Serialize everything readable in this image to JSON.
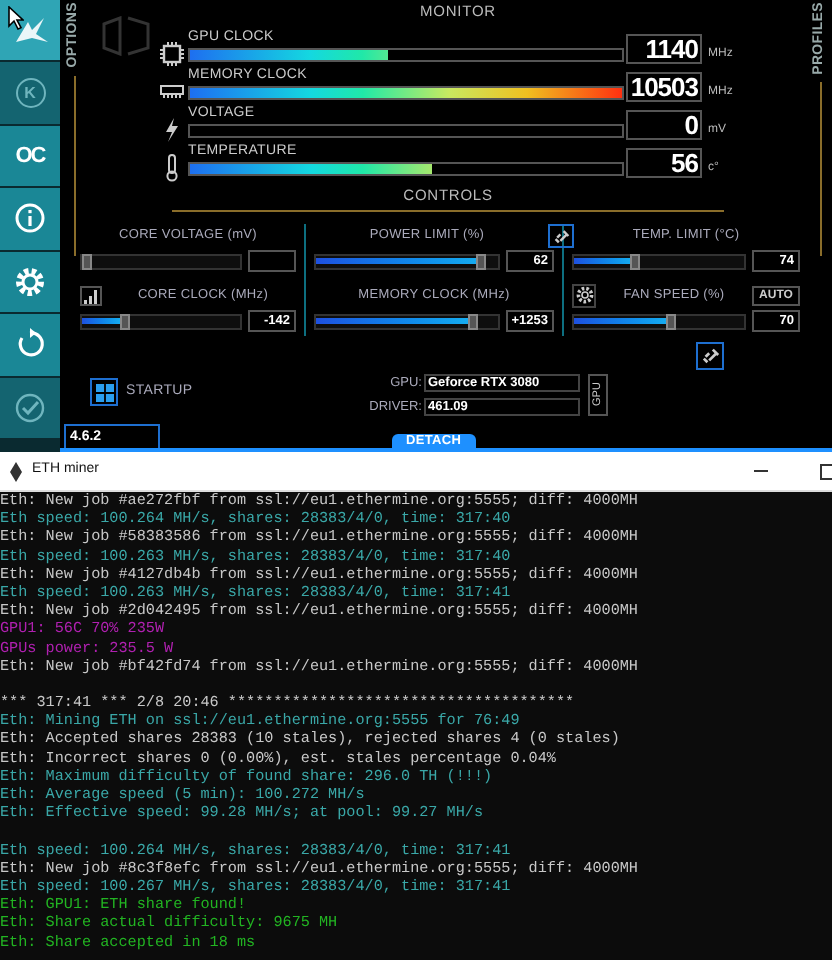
{
  "sidebar": {
    "items": [
      {
        "kind": "logo",
        "selected": true,
        "disabled": false
      },
      {
        "kind": "badge",
        "label": "K",
        "selected": false,
        "disabled": true
      },
      {
        "kind": "text",
        "label": "OC",
        "selected": false,
        "disabled": false
      },
      {
        "kind": "info",
        "selected": false,
        "disabled": false
      },
      {
        "kind": "settings",
        "selected": false,
        "disabled": false
      },
      {
        "kind": "reset",
        "selected": false,
        "disabled": false
      },
      {
        "kind": "apply",
        "selected": false,
        "disabled": true
      }
    ]
  },
  "options_label": "OPTIONS",
  "profiles_label": "PROFILES",
  "monitor": {
    "title": "MONITOR",
    "rows": [
      {
        "kind": "chip",
        "label": "GPU CLOCK",
        "level": 0.46,
        "value": "1140",
        "unit": "MHz"
      },
      {
        "kind": "memory",
        "label": "MEMORY CLOCK",
        "level": 1,
        "value": "10503",
        "unit": "MHz"
      },
      {
        "kind": "voltage",
        "label": "VOLTAGE",
        "level": 0,
        "value": "0",
        "unit": "mV"
      },
      {
        "kind": "temperature",
        "label": "TEMPERATURE",
        "level": 0.56,
        "value": "56",
        "unit": "c°"
      }
    ]
  },
  "controls": {
    "title": "CONTROLS",
    "sliders": [
      {
        "label": "CORE VOLTAGE (mV)",
        "level": 0
      },
      {
        "label": "POWER LIMIT (%)",
        "level": 0.93,
        "value": "62"
      },
      {
        "label": "TEMP. LIMIT (°C)",
        "level": 0.35,
        "value": "74"
      },
      {
        "label": "CORE CLOCK (MHz)",
        "level": 0.25,
        "value": "-142",
        "kind": "curve"
      },
      {
        "label": "MEMORY CLOCK (MHz)",
        "level": 0.88,
        "value": "+1253"
      },
      {
        "label": "FAN SPEED (%)",
        "level": 0.58,
        "value": "70",
        "kind": "fan",
        "button": "AUTO"
      }
    ]
  },
  "startup": "STARTUP",
  "gpu_info": {
    "gpu_label": "GPU:",
    "gpu": "Geforce RTX 3080",
    "driver_label": "DRIVER:",
    "driver": "461.09",
    "gpu_tab": "GPU"
  },
  "version": "4.6.2",
  "detach": "DETACH",
  "terminal": {
    "title": "ETH miner",
    "lines": [
      {
        "kind": "info",
        "text": "Eth: New job #ae272fbf from ssl://eu1.ethermine.org:5555; diff: 4000MH"
      },
      {
        "kind": "speed",
        "text": "Eth speed: 100.264 MH/s, shares: 28383/4/0, time: 317:40"
      },
      {
        "kind": "info",
        "text": "Eth: New job #58383586 from ssl://eu1.ethermine.org:5555; diff: 4000MH"
      },
      {
        "kind": "speed",
        "text": "Eth speed: 100.263 MH/s, shares: 28383/4/0, time: 317:40"
      },
      {
        "kind": "info",
        "text": "Eth: New job #4127db4b from ssl://eu1.ethermine.org:5555; diff: 4000MH"
      },
      {
        "kind": "speed",
        "text": "Eth speed: 100.263 MH/s, shares: 28383/4/0, time: 317:41"
      },
      {
        "kind": "info",
        "text": "Eth: New job #2d042495 from ssl://eu1.ethermine.org:5555; diff: 4000MH"
      },
      {
        "kind": "power",
        "text": "GPU1: 56C 70% 235W"
      },
      {
        "kind": "power",
        "text": "GPUs power: 235.5 W"
      },
      {
        "kind": "info",
        "text": "Eth: New job #bf42fd74 from ssl://eu1.ethermine.org:5555; diff: 4000MH"
      },
      {
        "kind": "blank"
      },
      {
        "kind": "info",
        "text": "*** 317:41 *** 2/8 20:46 **************************************"
      },
      {
        "kind": "speed",
        "text": "Eth: Mining ETH on ssl://eu1.ethermine.org:5555 for 76:49"
      },
      {
        "kind": "info",
        "text": "Eth: Accepted shares 28383 (10 stales), rejected shares 4 (0 stales)"
      },
      {
        "kind": "info",
        "text": "Eth: Incorrect shares 0 (0.00%), est. stales percentage 0.04%"
      },
      {
        "kind": "speed",
        "text": "Eth: Maximum difficulty of found share: 296.0 TH (!!!)"
      },
      {
        "kind": "speed",
        "text": "Eth: Average speed (5 min): 100.272 MH/s"
      },
      {
        "kind": "speed",
        "text": "Eth: Effective speed: 99.28 MH/s; at pool: 99.27 MH/s"
      },
      {
        "kind": "blank"
      },
      {
        "kind": "speed",
        "text": "Eth speed: 100.264 MH/s, shares: 28383/4/0, time: 317:41"
      },
      {
        "kind": "info",
        "text": "Eth: New job #8c3f8efc from ssl://eu1.ethermine.org:5555; diff: 4000MH"
      },
      {
        "kind": "speed",
        "text": "Eth speed: 100.267 MH/s, shares: 28383/4/0, time: 317:41"
      },
      {
        "kind": "share",
        "text": "Eth: GPU1: ETH share found!"
      },
      {
        "kind": "share",
        "text": "Eth: Share actual difficulty: 9675 MH"
      },
      {
        "kind": "share",
        "text": "Eth: Share accepted in 18 ms"
      }
    ]
  }
}
